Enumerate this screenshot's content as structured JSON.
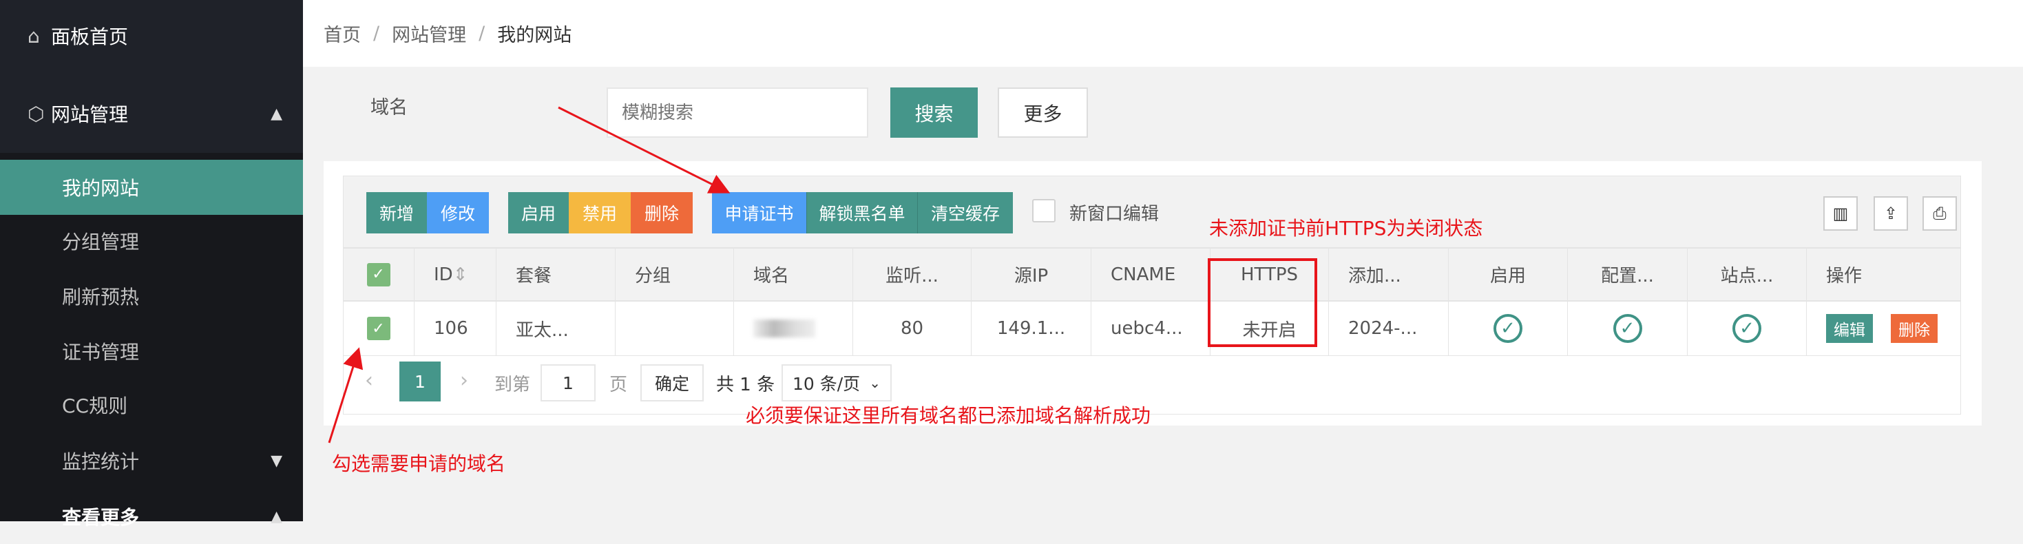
{
  "sidebar": {
    "items": [
      {
        "label": "面板首页",
        "icon": "home-icon"
      },
      {
        "label": "网站管理",
        "icon": "cube-icon",
        "expanded": true
      },
      {
        "label": "我的网站",
        "active": true
      },
      {
        "label": "分组管理"
      },
      {
        "label": "刷新预热"
      },
      {
        "label": "证书管理"
      },
      {
        "label": "CC规则"
      },
      {
        "label": "监控统计"
      },
      {
        "label": "查看更多"
      }
    ]
  },
  "breadcrumb": [
    "首页",
    "网站管理",
    "我的网站"
  ],
  "search": {
    "label": "域名",
    "placeholder": "模糊搜索",
    "search_button": "搜索",
    "more_button": "更多"
  },
  "toolbar": {
    "add": "新增",
    "edit": "修改",
    "enable": "启用",
    "disable": "禁用",
    "delete": "删除",
    "apply_cert": "申请证书",
    "unlock_blacklist": "解锁黑名单",
    "clear_cache": "清空缓存",
    "new_window_edit": "新窗口编辑",
    "icons": [
      "columns-icon",
      "export-icon",
      "print-icon"
    ]
  },
  "table": {
    "headers": [
      "ID",
      "套餐",
      "分组",
      "域名",
      "监听...",
      "源IP",
      "CNAME",
      "HTTPS",
      "添加...",
      "启用",
      "配置...",
      "站点...",
      "操作"
    ],
    "rows": [
      {
        "checked": true,
        "id": "106",
        "package": "亚太...",
        "group": "",
        "domain": "",
        "port": "80",
        "source_ip": "149.1...",
        "cname": "uebc4...",
        "https": "未开启",
        "added": "2024-...",
        "enabled": true,
        "config": true,
        "site": true,
        "edit": "编辑",
        "delete": "删除"
      }
    ]
  },
  "pagination": {
    "current": "1",
    "goto_label": "到第",
    "goto_value": "1",
    "page_label": "页",
    "confirm": "确定",
    "total": "共 1 条",
    "page_size": "10 条/页"
  },
  "annotations": {
    "https_note": "未添加证书前HTTPS为关闭状态",
    "domain_note": "必须要保证这里所有域名都已添加域名解析成功",
    "check_note": "勾选需要申请的域名"
  },
  "colors": {
    "primary": "#45968a",
    "blue": "#4e9ef5",
    "yellow": "#f5b840",
    "orange": "#ee6a3a",
    "annotation": "#e8151b"
  }
}
